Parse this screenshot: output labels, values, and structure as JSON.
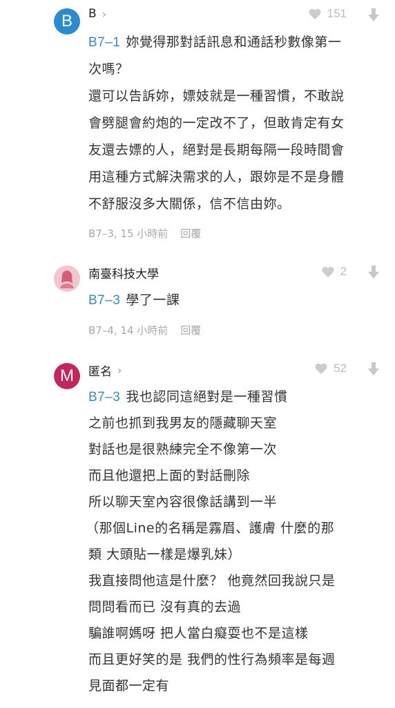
{
  "comments": [
    {
      "avatar_letter": "B",
      "avatar_color": "#2c8ad1",
      "author": "B",
      "chevron": "›",
      "likes": "151",
      "ref": "B7–1",
      "lines": [
        "妳覺得那對話訊息和通話秒數像第一",
        "次嗎？",
        "還可以告訴妳，嫖妓就是一種習慣，不敢說",
        "會劈腿會約炮的一定改不了，但敢肯定有女",
        "友還去嫖的人，絕對是長期每隔一段時間會",
        "用這種方式解決需求的人，跟妳是不是身體",
        "不舒服沒多大關係，信不信由妳。"
      ],
      "meta": "B7–3, 15 小時前",
      "reply": "回覆"
    },
    {
      "avatar_color": "#f2c6cf",
      "author": "南臺科技大學",
      "likes": "2",
      "ref": "B7–3",
      "lines": [
        "學了一課"
      ],
      "meta": "B7–4, 14 小時前",
      "reply": "回覆"
    },
    {
      "avatar_letter": "M",
      "avatar_color": "#c2265f",
      "author": "匿名",
      "chevron": "›",
      "likes": "52",
      "ref": "B7–3",
      "lines": [
        "我也認同這絕對是一種習慣",
        "之前也抓到我男友的隱藏聊天室",
        "對話也是很熟練完全不像第一次",
        "而且他還把上面的對話刪除",
        "所以聊天室內容很像話講到一半",
        "（那個Line的名稱是霧眉、護膚 什麼的那",
        "類 大頭貼一樣是爆乳妹）",
        "我直接問他這是什麼？ 他竟然回我說只是",
        "問問看而已 沒有真的去過",
        "騙誰啊媽呀 把人當白癡耍也不是這樣",
        "而且更好笑的是 我們的性行為頻率是每週",
        "見面都一定有"
      ]
    }
  ],
  "colors": {
    "ref": "#3a88b8",
    "muted": "#a8a8a8",
    "heart": "#cccccc"
  }
}
